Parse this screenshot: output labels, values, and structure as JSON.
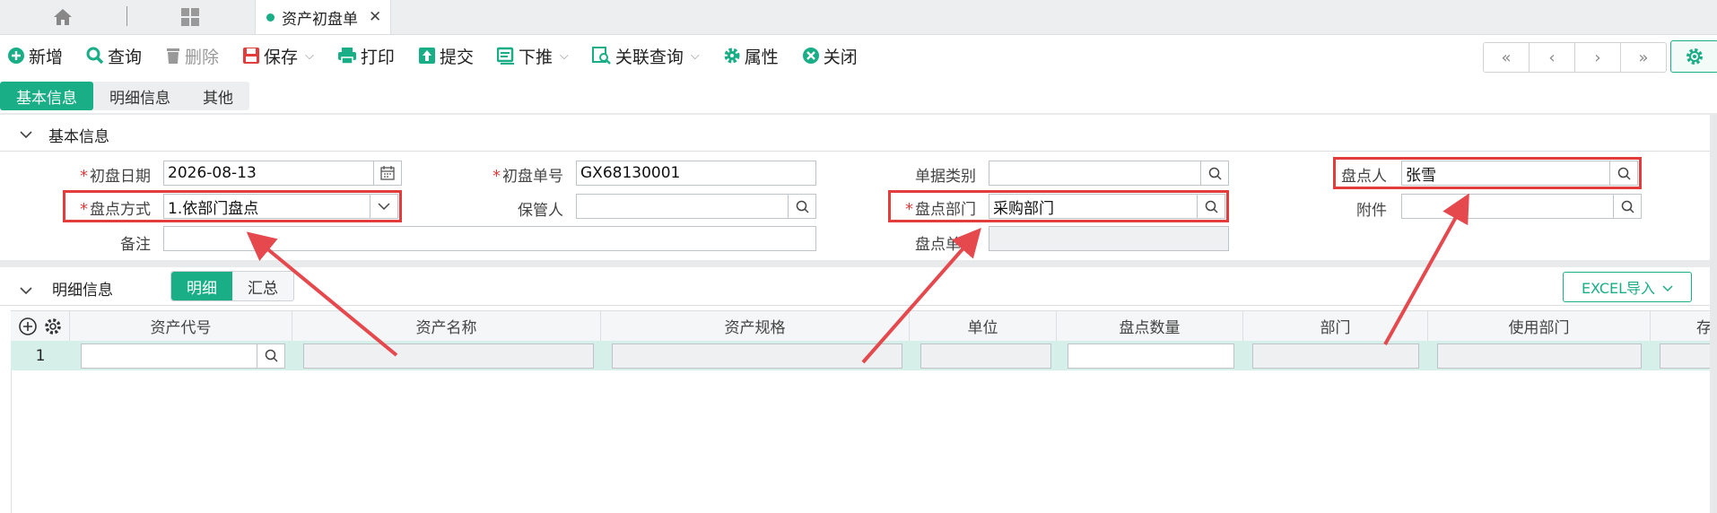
{
  "top_tabs": {
    "doc_tab_title": "资产初盘单",
    "close_glyph": "✕"
  },
  "toolbar": {
    "new": "新增",
    "query": "查询",
    "delete": "删除",
    "save": "保存",
    "print": "打印",
    "submit": "提交",
    "push_down": "下推",
    "related_query": "关联查询",
    "properties": "属性",
    "close": "关闭"
  },
  "nav": {
    "first": "«",
    "prev": "‹",
    "next": "›",
    "last": "»"
  },
  "section_tabs": [
    "基本信息",
    "明细信息",
    "其他"
  ],
  "basic_section": {
    "title": "基本信息"
  },
  "form": {
    "initial_date_label": "初盘日期",
    "initial_date_value": "2026-08-13",
    "initial_no_label": "初盘单号",
    "initial_no_value": "GX68130001",
    "doc_type_label": "单据类别",
    "doc_type_value": "",
    "counter_label": "盘点人",
    "counter_value": "张雪",
    "method_label": "盘点方式",
    "method_value": "1.依部门盘点",
    "keeper_label": "保管人",
    "keeper_value": "",
    "dept_label": "盘点部门",
    "dept_value": "采购部门",
    "attachment_label": "附件",
    "attachment_value": "",
    "remark_label": "备注",
    "remark_value": "",
    "count_doc_label": "盘点单号",
    "count_doc_value": ""
  },
  "detail_section": {
    "title": "明细信息",
    "seg_detail": "明细",
    "seg_summary": "汇总",
    "excel_import": "EXCEL导入",
    "columns": [
      "资产代号",
      "资产名称",
      "资产规格",
      "单位",
      "盘点数量",
      "部门",
      "使用部门",
      "存"
    ],
    "row_number": "1"
  },
  "colors": {
    "accent": "#1aae86",
    "highlight": "#e23c3c"
  }
}
